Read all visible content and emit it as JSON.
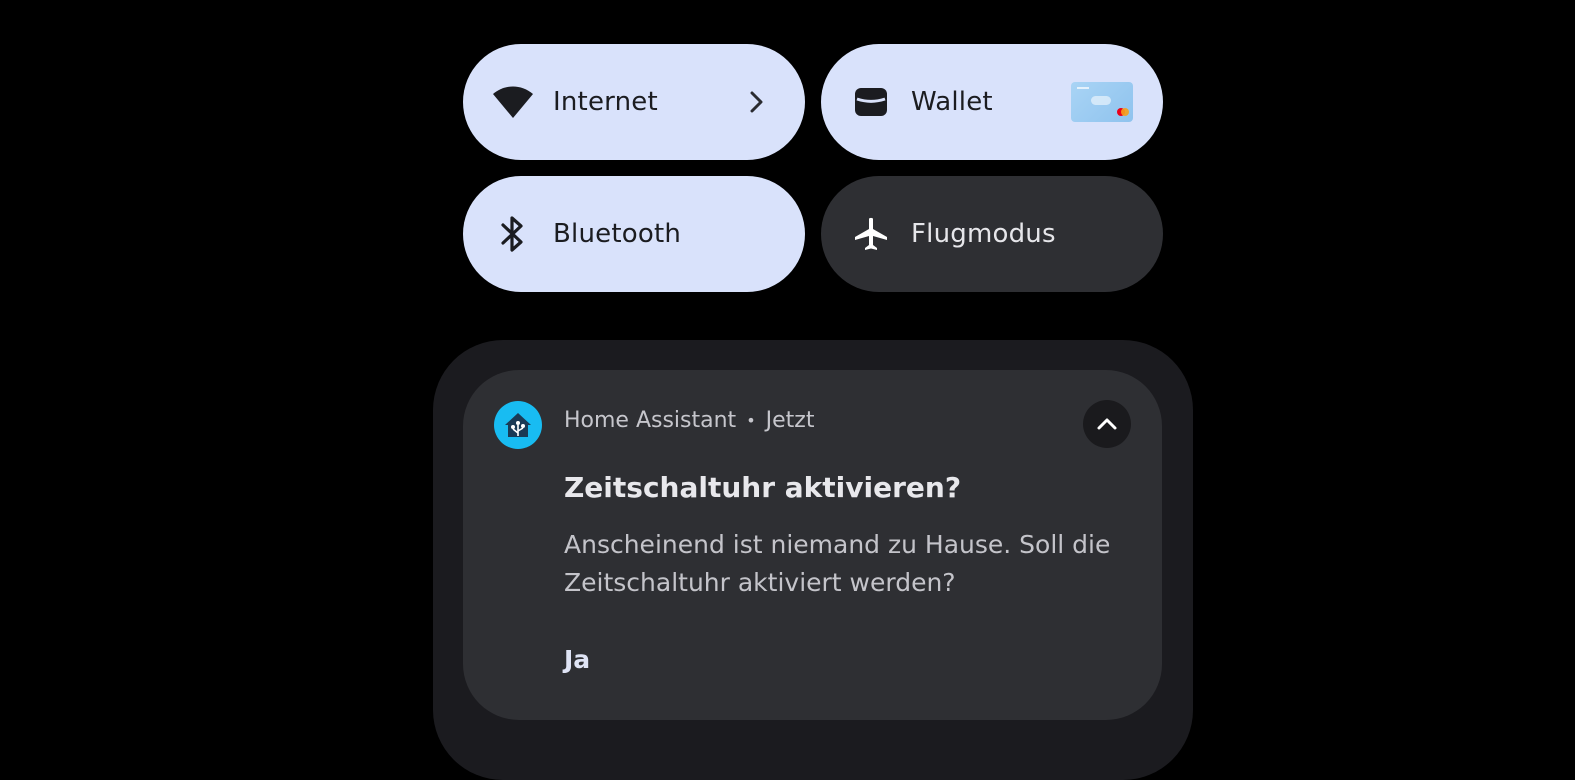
{
  "quick_settings": {
    "tiles": [
      {
        "id": "internet",
        "label": "Internet",
        "state": "on",
        "icon": "wifi-icon"
      },
      {
        "id": "wallet",
        "label": "Wallet",
        "state": "on",
        "icon": "wallet-icon"
      },
      {
        "id": "bluetooth",
        "label": "Bluetooth",
        "state": "on",
        "icon": "bluetooth-icon"
      },
      {
        "id": "flugmodus",
        "label": "Flugmodus",
        "state": "off",
        "icon": "airplane-icon"
      }
    ]
  },
  "notification": {
    "app_name": "Home Assistant",
    "separator": "•",
    "time": "Jetzt",
    "title": "Zeitschaltuhr aktivieren?",
    "body": "Anscheinend ist niemand zu Hause. Soll die Zeitschaltuhr aktiviert werden?",
    "action_label": "Ja",
    "app_icon": "home-assistant-icon",
    "app_icon_color": "#18bcf2"
  },
  "colors": {
    "tile_on": "#d9e2fb",
    "tile_off": "#2e2f33",
    "card_bg": "#2e2f33",
    "shade_bg": "#1b1b1f"
  }
}
